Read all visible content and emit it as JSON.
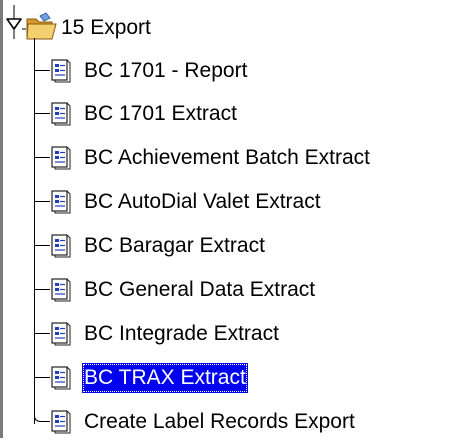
{
  "tree": {
    "parent": {
      "label": "15 Export",
      "icon": "open-folder-icon",
      "expander_icon": "expanded-toggle-icon",
      "expanded": true
    },
    "children": [
      {
        "label": "BC 1701 - Report",
        "icon": "report-document-icon",
        "selected": false
      },
      {
        "label": "BC 1701 Extract",
        "icon": "report-document-icon",
        "selected": false
      },
      {
        "label": "BC Achievement Batch Extract",
        "icon": "report-document-icon",
        "selected": false
      },
      {
        "label": "BC AutoDial Valet Extract",
        "icon": "report-document-icon",
        "selected": false
      },
      {
        "label": "BC Baragar Extract",
        "icon": "report-document-icon",
        "selected": false
      },
      {
        "label": "BC General Data Extract",
        "icon": "report-document-icon",
        "selected": false
      },
      {
        "label": "BC Integrade Extract",
        "icon": "report-document-icon",
        "selected": false
      },
      {
        "label": "BC TRAX Extract",
        "icon": "report-document-icon",
        "selected": true
      },
      {
        "label": "Create Label Records Export",
        "icon": "report-document-icon",
        "selected": false
      }
    ]
  },
  "colors": {
    "selection_background": "#0000ee",
    "selection_text": "#ffffff",
    "text": "#000000",
    "folder": "#e8b84a",
    "document_accent": "#1f3fbf"
  }
}
